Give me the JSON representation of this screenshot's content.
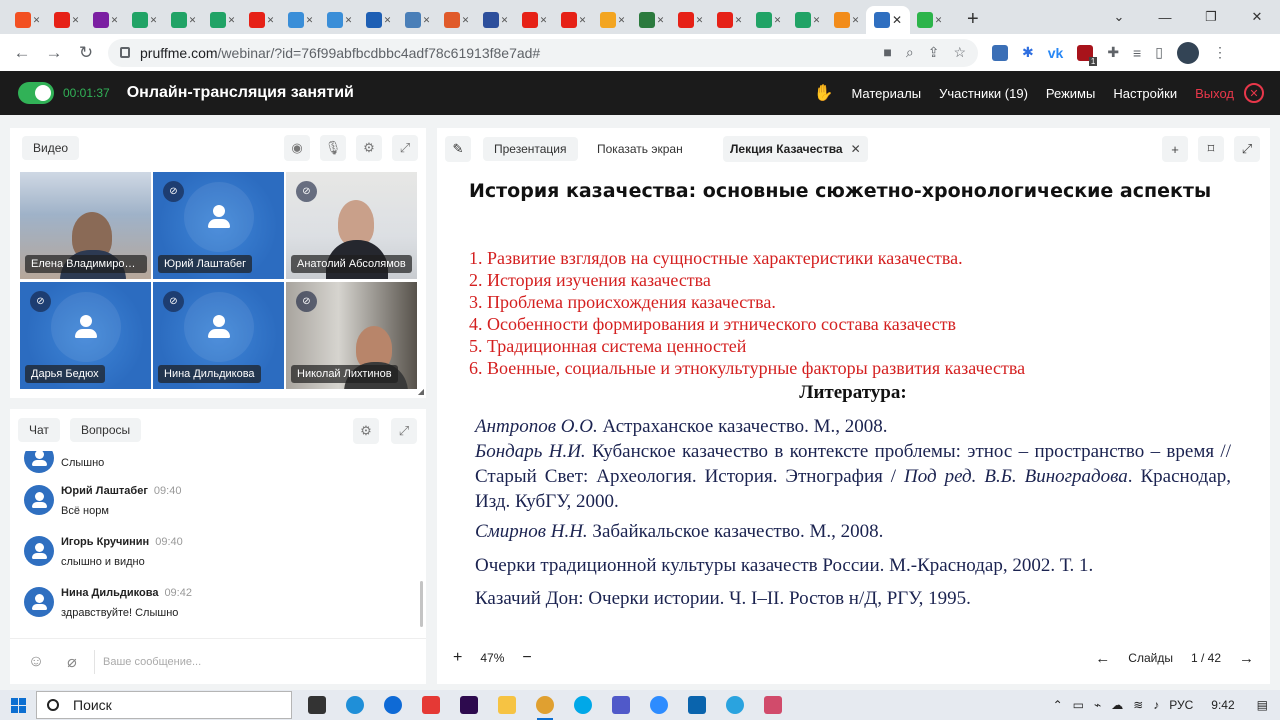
{
  "browser": {
    "tabs": [
      {
        "icon": "windows-icon",
        "color": "#f25022"
      },
      {
        "icon": "youtube-icon",
        "color": "#e62117"
      },
      {
        "icon": "wildberries-icon",
        "color": "#7b1fa2"
      },
      {
        "icon": "sheets-icon",
        "color": "#21a366"
      },
      {
        "icon": "sheets-icon",
        "color": "#21a366"
      },
      {
        "icon": "sheets-icon",
        "color": "#21a366"
      },
      {
        "icon": "youtube-icon",
        "color": "#e62117"
      },
      {
        "icon": "megaphone-icon",
        "color": "#3a8ed8"
      },
      {
        "icon": "megaphone-icon",
        "color": "#3a8ed8"
      },
      {
        "icon": "globe-icon",
        "color": "#1e5fb4"
      },
      {
        "icon": "eye-icon",
        "color": "#4a7fb8"
      },
      {
        "icon": "circle-c-icon",
        "color": "#e05a2a"
      },
      {
        "icon": "triangle-icon",
        "color": "#2d4f9c"
      },
      {
        "icon": "youtube-icon",
        "color": "#e62117"
      },
      {
        "icon": "youtube-icon",
        "color": "#e62117"
      },
      {
        "icon": "coin-icon",
        "color": "#f3a521"
      },
      {
        "icon": "stack-icon",
        "color": "#2b7a3e"
      },
      {
        "icon": "youtube-icon",
        "color": "#e62117"
      },
      {
        "icon": "youtube-icon",
        "color": "#e62117"
      },
      {
        "icon": "sheets-icon",
        "color": "#21a366"
      },
      {
        "icon": "sheets-icon",
        "color": "#21a366"
      },
      {
        "icon": "m-icon",
        "color": "#f28c1a"
      },
      {
        "icon": "pruffme-icon",
        "color": "#2f6fc0",
        "active": true
      },
      {
        "icon": "one-icon",
        "color": "#2cb44a"
      }
    ],
    "url_domain": "pruffme.com",
    "url_path": "/webinar/?id=76f99abfbcdbbc4adf78c61913f8e7ad#",
    "extension_badge": "1"
  },
  "header": {
    "timer": "00:01:37",
    "title": "Онлайн-трансляция занятий",
    "menu": [
      "Материалы",
      "Участники (19)",
      "Режимы",
      "Настройки"
    ],
    "exit_label": "Выход"
  },
  "video": {
    "tab_label": "Видео",
    "participants": [
      {
        "name": "Елена Владимировн...",
        "type": "photo1"
      },
      {
        "name": "Юрий Лаштабег",
        "type": "avatar"
      },
      {
        "name": "Анатолий Абсолямов",
        "type": "photo2"
      },
      {
        "name": "Дарья Бедюх",
        "type": "avatar"
      },
      {
        "name": "Нина Дильдикова",
        "type": "avatar"
      },
      {
        "name": "Николай Лихтинов",
        "type": "photo3"
      }
    ]
  },
  "chat": {
    "tabs": [
      "Чат",
      "Вопросы"
    ],
    "partial_message": "Слышно",
    "messages": [
      {
        "author": "Юрий Лаштабег",
        "time": "09:40",
        "text": "Всё норм"
      },
      {
        "author": "Игорь Кручинин",
        "time": "09:40",
        "text": "слышно и видно"
      },
      {
        "author": "Нина Дильдикова",
        "time": "09:42",
        "text": "здравствуйте! Слышно"
      }
    ],
    "input_placeholder": "Ваше сообщение..."
  },
  "presentation": {
    "tabs": [
      "Презентация",
      "Показать экран"
    ],
    "doc_title": "Лекция Казачества",
    "slide": {
      "title": "История казачества: основные сюжетно-хронологические аспекты",
      "topics": [
        "1. Развитие взглядов на сущностные характеристики казачества.",
        "2. История изучения казачества",
        "3. Проблема происхождения казачества.",
        "4. Особенности формирования и этнического состава казачеств",
        "5. Традиционная система ценностей",
        "6. Военные, социальные и этнокультурные факторы развития казачества"
      ],
      "literature_heading": "Литература:",
      "literature": {
        "ref1_author": "Антропов О.О.",
        "ref1_text": " Астраханское казачество. М., 2008.",
        "ref2_author": "Бондарь Н.И.",
        "ref2_text": " Кубанское казачество в контексте проблемы: этнос – пространство – время // Старый Свет: Археология. История. Этнография / ",
        "ref2_editor": "Под ред. В.Б. Виноградова",
        "ref2_tail": ". Краснодар, Изд. КубГУ, 2000.",
        "ref3_author": "Смирнов Н.Н.",
        "ref3_text": " Забайкальское казачество. М., 2008.",
        "ref4": "Очерки традиционной культуры казачеств России. М.-Краснодар, 2002. Т. 1.",
        "ref5": "Казачий Дон: Очерки истории. Ч. I–II. Ростов н/Д, РГУ, 1995."
      }
    },
    "zoom": "47%",
    "slides_label": "Слайды",
    "page": "1 / 42"
  },
  "taskbar": {
    "search_label": "Поиск",
    "apps": [
      {
        "icon": "task-view-icon",
        "color": "#333333"
      },
      {
        "icon": "edge-icon",
        "color": "#1f8fd8"
      },
      {
        "icon": "teamviewer-icon",
        "color": "#0e6ad6"
      },
      {
        "icon": "anydesk-icon",
        "color": "#e53935"
      },
      {
        "icon": "premiere-icon",
        "color": "#2d0a4e"
      },
      {
        "icon": "folder-icon",
        "color": "#f6c343"
      },
      {
        "icon": "chrome-icon",
        "color": "#e0a030",
        "running": true
      },
      {
        "icon": "skype-icon",
        "color": "#00a8e8"
      },
      {
        "icon": "teams-icon",
        "color": "#5059c9"
      },
      {
        "icon": "zoom-icon",
        "color": "#2d8cff"
      },
      {
        "icon": "outlook-icon",
        "color": "#0a64ad"
      },
      {
        "icon": "telegram-icon",
        "color": "#2aa3df"
      },
      {
        "icon": "snip-icon",
        "color": "#d14b6b"
      }
    ],
    "language": "РУС",
    "time": "9:42"
  },
  "colors": {
    "accent_green": "#31b257",
    "exit_red": "#e8374a",
    "topic_red": "#d42020",
    "literature_blue": "#1b2350",
    "avatar_blue": "#2f6fc0"
  }
}
